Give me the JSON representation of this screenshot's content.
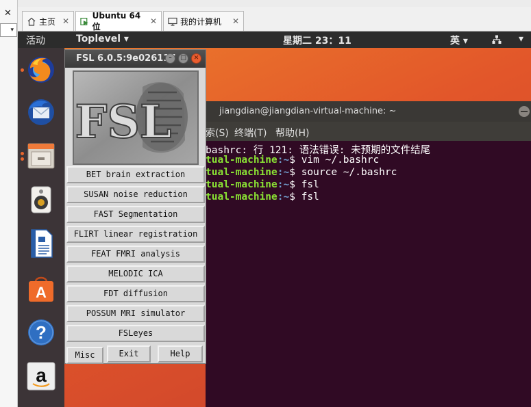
{
  "host": {
    "close_glyph": "✕",
    "dropdown_glyph": "▾"
  },
  "tabs": [
    {
      "label": "主页",
      "icon": "home-icon"
    },
    {
      "label": "Ubuntu 64 位",
      "icon": "vm-icon"
    },
    {
      "label": "我的计算机",
      "icon": "computer-icon"
    }
  ],
  "tab_close_glyph": "✕",
  "topbar": {
    "activities": "活动",
    "app_menu": "Toplevel ▾",
    "clock": "星期二 23：11",
    "input_method": "英 ▾",
    "power_glyph": "▾"
  },
  "dock_icons": [
    "firefox-icon",
    "thunderbird-icon",
    "files-icon",
    "rhythmbox-icon",
    "writer-icon",
    "software-center-icon",
    "help-icon",
    "amazon-icon"
  ],
  "terminal": {
    "title": "jiangdian@jiangdian-virtual-machine: ~",
    "menu": [
      "索(S)",
      "终端(T)",
      "帮助(H)"
    ],
    "lines": [
      {
        "prefix": "",
        "path": "",
        "text": "bashrc: 行 121: 语法错误: 未预期的文件结尾"
      },
      {
        "prefix": "tual-machine",
        "path": ":~",
        "text": "$ vim ~/.bashrc"
      },
      {
        "prefix": "tual-machine",
        "path": ":~",
        "text": "$ source ~/.bashrc"
      },
      {
        "prefix": "tual-machine",
        "path": ":~",
        "text": "$ fsl"
      },
      {
        "prefix": "tual-machine",
        "path": ":~",
        "text": "$ fsl"
      }
    ]
  },
  "fsl": {
    "title": "FSL 6.0.5:9e026117",
    "logo_text": "FSL",
    "buttons": [
      "BET brain extraction",
      "SUSAN noise reduction",
      "FAST Segmentation",
      "FLIRT linear registration",
      "FEAT FMRI analysis",
      "MELODIC ICA",
      "FDT diffusion",
      "POSSUM MRI simulator",
      "FSLeyes"
    ],
    "misc_label": "Misc",
    "exit_label": "Exit",
    "help_label": "Help"
  },
  "colors": {
    "terminal_bg": "#300a24",
    "prompt_green": "#8ae234",
    "prompt_blue": "#729fcf",
    "ubuntu_orange": "#e95420"
  }
}
